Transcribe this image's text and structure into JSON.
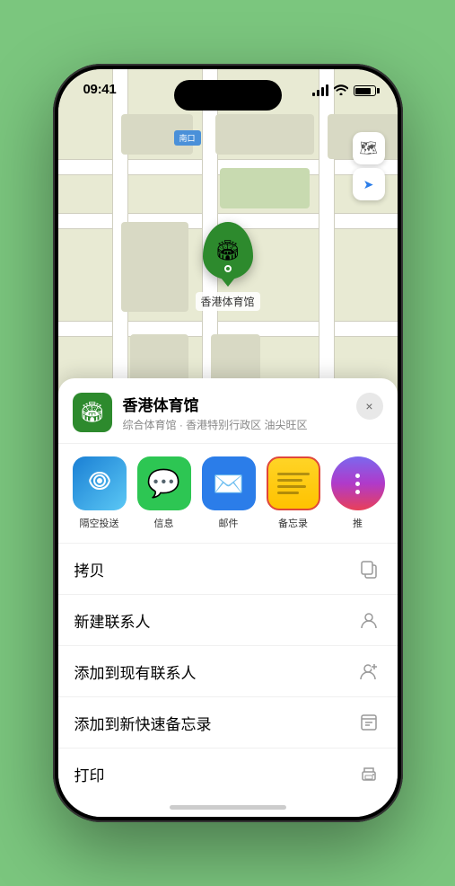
{
  "status_bar": {
    "time": "09:41",
    "location_arrow": "▶"
  },
  "map": {
    "label_text": "南口",
    "stadium_name": "香港体育馆",
    "stadium_label_display": "香港体育馆"
  },
  "map_controls": {
    "map_btn_label": "🗺",
    "location_btn_label": "➤"
  },
  "venue": {
    "name": "香港体育馆",
    "subtitle": "综合体育馆 · 香港特别行政区 油尖旺区",
    "close_label": "×"
  },
  "share_items": [
    {
      "id": "airdrop",
      "label": "隔空投送",
      "icon": "📡"
    },
    {
      "id": "messages",
      "label": "信息",
      "icon": "💬"
    },
    {
      "id": "mail",
      "label": "邮件",
      "icon": "✉️"
    },
    {
      "id": "notes",
      "label": "备忘录",
      "icon": ""
    },
    {
      "id": "more",
      "label": "推",
      "icon": ""
    }
  ],
  "actions": [
    {
      "id": "copy",
      "label": "拷贝",
      "icon": "⎘"
    },
    {
      "id": "new-contact",
      "label": "新建联系人",
      "icon": "👤"
    },
    {
      "id": "add-contact",
      "label": "添加到现有联系人",
      "icon": "👤"
    },
    {
      "id": "quick-note",
      "label": "添加到新快速备忘录",
      "icon": "⊡"
    },
    {
      "id": "print",
      "label": "打印",
      "icon": "🖨"
    }
  ]
}
